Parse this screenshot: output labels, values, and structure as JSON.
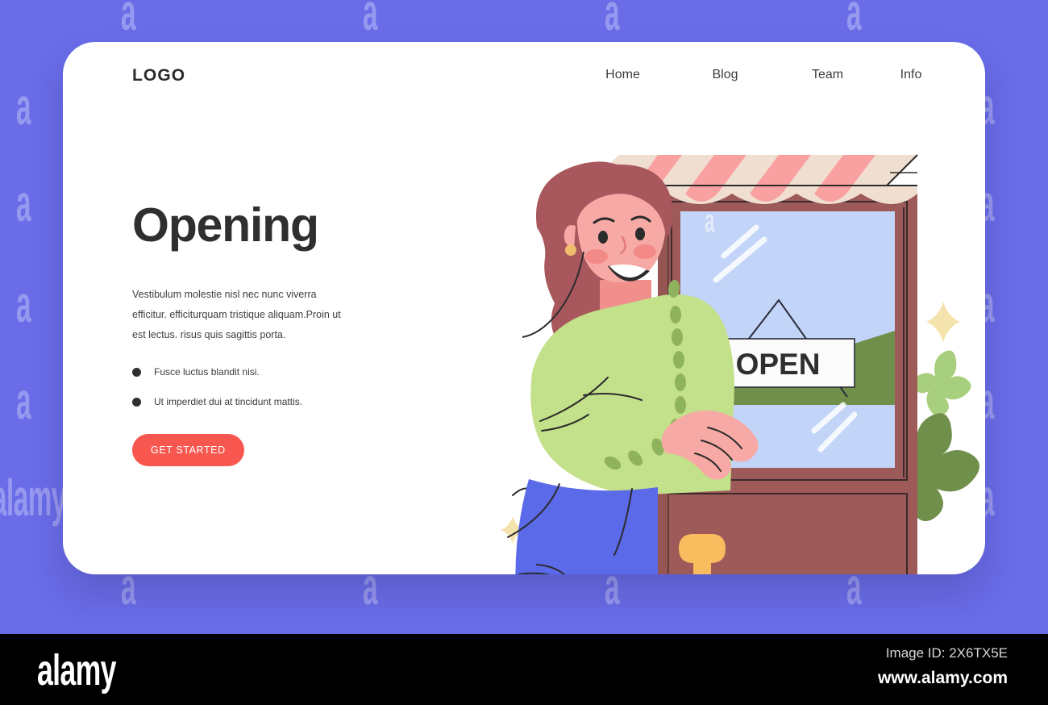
{
  "theme": {
    "background_purple": "#6a6ce8",
    "card_white": "#ffffff",
    "accent_red": "#f8574f",
    "text_dark": "#2f2f2f",
    "awning_pink": "#f9a0a0",
    "awning_cream": "#f0dfd0",
    "frame_red": "#9d5a58",
    "glass_blue": "#c2d4f7",
    "grass_green": "#6f8f4a",
    "cardigan_green": "#c3e08a",
    "skirt_blue": "#5a6ae8",
    "hair_auburn": "#a8585c",
    "skin_pink": "#f7a9a5",
    "handle_orange": "#f9bc5f",
    "sparkle_cream": "#f5e3ad",
    "leaf_dark": "#6f8f4a",
    "leaf_light": "#a8cf7e"
  },
  "header": {
    "logo": "LOGO",
    "nav": [
      {
        "label": "Home"
      },
      {
        "label": "Blog"
      },
      {
        "label": "Team"
      },
      {
        "label": "Info"
      }
    ]
  },
  "hero": {
    "headline": "Opening",
    "paragraph": "Vestibulum molestie nisl nec nunc viverra efficitur. efficiturquam tristique aliquam.Proin ut est lectus. risus quis sagittis porta.",
    "bullets": [
      {
        "text": "Fusce luctus blandit nisi."
      },
      {
        "text": "Ut imperdiet dui at tincidunt mattis."
      }
    ],
    "cta_label": "GET STARTED"
  },
  "illustration": {
    "sign_text": "OPEN",
    "description": "Smiling woman in green cardigan and blue skirt opening a shop door with a striped awning and an OPEN sign"
  },
  "watermark": {
    "text": "alamy",
    "letter": "a"
  },
  "footer": {
    "brand": "alamy",
    "image_id": "Image ID: 2X6TX5E",
    "url": "www.alamy.com"
  }
}
